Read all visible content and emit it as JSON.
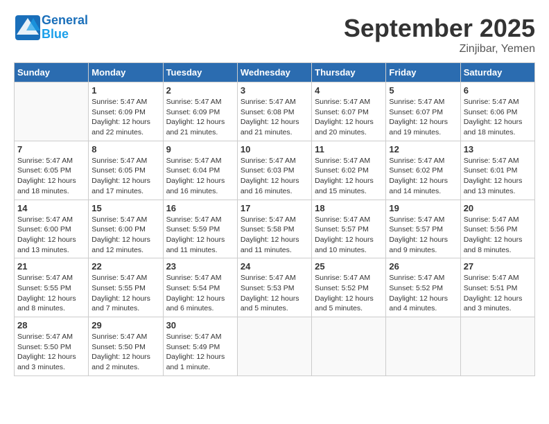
{
  "header": {
    "logo_line1": "General",
    "logo_line2": "Blue",
    "month": "September 2025",
    "location": "Zinjibar, Yemen"
  },
  "weekdays": [
    "Sunday",
    "Monday",
    "Tuesday",
    "Wednesday",
    "Thursday",
    "Friday",
    "Saturday"
  ],
  "weeks": [
    [
      {
        "day": "",
        "info": ""
      },
      {
        "day": "1",
        "info": "Sunrise: 5:47 AM\nSunset: 6:09 PM\nDaylight: 12 hours\nand 22 minutes."
      },
      {
        "day": "2",
        "info": "Sunrise: 5:47 AM\nSunset: 6:09 PM\nDaylight: 12 hours\nand 21 minutes."
      },
      {
        "day": "3",
        "info": "Sunrise: 5:47 AM\nSunset: 6:08 PM\nDaylight: 12 hours\nand 21 minutes."
      },
      {
        "day": "4",
        "info": "Sunrise: 5:47 AM\nSunset: 6:07 PM\nDaylight: 12 hours\nand 20 minutes."
      },
      {
        "day": "5",
        "info": "Sunrise: 5:47 AM\nSunset: 6:07 PM\nDaylight: 12 hours\nand 19 minutes."
      },
      {
        "day": "6",
        "info": "Sunrise: 5:47 AM\nSunset: 6:06 PM\nDaylight: 12 hours\nand 18 minutes."
      }
    ],
    [
      {
        "day": "7",
        "info": "Sunrise: 5:47 AM\nSunset: 6:05 PM\nDaylight: 12 hours\nand 18 minutes."
      },
      {
        "day": "8",
        "info": "Sunrise: 5:47 AM\nSunset: 6:05 PM\nDaylight: 12 hours\nand 17 minutes."
      },
      {
        "day": "9",
        "info": "Sunrise: 5:47 AM\nSunset: 6:04 PM\nDaylight: 12 hours\nand 16 minutes."
      },
      {
        "day": "10",
        "info": "Sunrise: 5:47 AM\nSunset: 6:03 PM\nDaylight: 12 hours\nand 16 minutes."
      },
      {
        "day": "11",
        "info": "Sunrise: 5:47 AM\nSunset: 6:02 PM\nDaylight: 12 hours\nand 15 minutes."
      },
      {
        "day": "12",
        "info": "Sunrise: 5:47 AM\nSunset: 6:02 PM\nDaylight: 12 hours\nand 14 minutes."
      },
      {
        "day": "13",
        "info": "Sunrise: 5:47 AM\nSunset: 6:01 PM\nDaylight: 12 hours\nand 13 minutes."
      }
    ],
    [
      {
        "day": "14",
        "info": "Sunrise: 5:47 AM\nSunset: 6:00 PM\nDaylight: 12 hours\nand 13 minutes."
      },
      {
        "day": "15",
        "info": "Sunrise: 5:47 AM\nSunset: 6:00 PM\nDaylight: 12 hours\nand 12 minutes."
      },
      {
        "day": "16",
        "info": "Sunrise: 5:47 AM\nSunset: 5:59 PM\nDaylight: 12 hours\nand 11 minutes."
      },
      {
        "day": "17",
        "info": "Sunrise: 5:47 AM\nSunset: 5:58 PM\nDaylight: 12 hours\nand 11 minutes."
      },
      {
        "day": "18",
        "info": "Sunrise: 5:47 AM\nSunset: 5:57 PM\nDaylight: 12 hours\nand 10 minutes."
      },
      {
        "day": "19",
        "info": "Sunrise: 5:47 AM\nSunset: 5:57 PM\nDaylight: 12 hours\nand 9 minutes."
      },
      {
        "day": "20",
        "info": "Sunrise: 5:47 AM\nSunset: 5:56 PM\nDaylight: 12 hours\nand 8 minutes."
      }
    ],
    [
      {
        "day": "21",
        "info": "Sunrise: 5:47 AM\nSunset: 5:55 PM\nDaylight: 12 hours\nand 8 minutes."
      },
      {
        "day": "22",
        "info": "Sunrise: 5:47 AM\nSunset: 5:55 PM\nDaylight: 12 hours\nand 7 minutes."
      },
      {
        "day": "23",
        "info": "Sunrise: 5:47 AM\nSunset: 5:54 PM\nDaylight: 12 hours\nand 6 minutes."
      },
      {
        "day": "24",
        "info": "Sunrise: 5:47 AM\nSunset: 5:53 PM\nDaylight: 12 hours\nand 5 minutes."
      },
      {
        "day": "25",
        "info": "Sunrise: 5:47 AM\nSunset: 5:52 PM\nDaylight: 12 hours\nand 5 minutes."
      },
      {
        "day": "26",
        "info": "Sunrise: 5:47 AM\nSunset: 5:52 PM\nDaylight: 12 hours\nand 4 minutes."
      },
      {
        "day": "27",
        "info": "Sunrise: 5:47 AM\nSunset: 5:51 PM\nDaylight: 12 hours\nand 3 minutes."
      }
    ],
    [
      {
        "day": "28",
        "info": "Sunrise: 5:47 AM\nSunset: 5:50 PM\nDaylight: 12 hours\nand 3 minutes."
      },
      {
        "day": "29",
        "info": "Sunrise: 5:47 AM\nSunset: 5:50 PM\nDaylight: 12 hours\nand 2 minutes."
      },
      {
        "day": "30",
        "info": "Sunrise: 5:47 AM\nSunset: 5:49 PM\nDaylight: 12 hours\nand 1 minute."
      },
      {
        "day": "",
        "info": ""
      },
      {
        "day": "",
        "info": ""
      },
      {
        "day": "",
        "info": ""
      },
      {
        "day": "",
        "info": ""
      }
    ]
  ]
}
